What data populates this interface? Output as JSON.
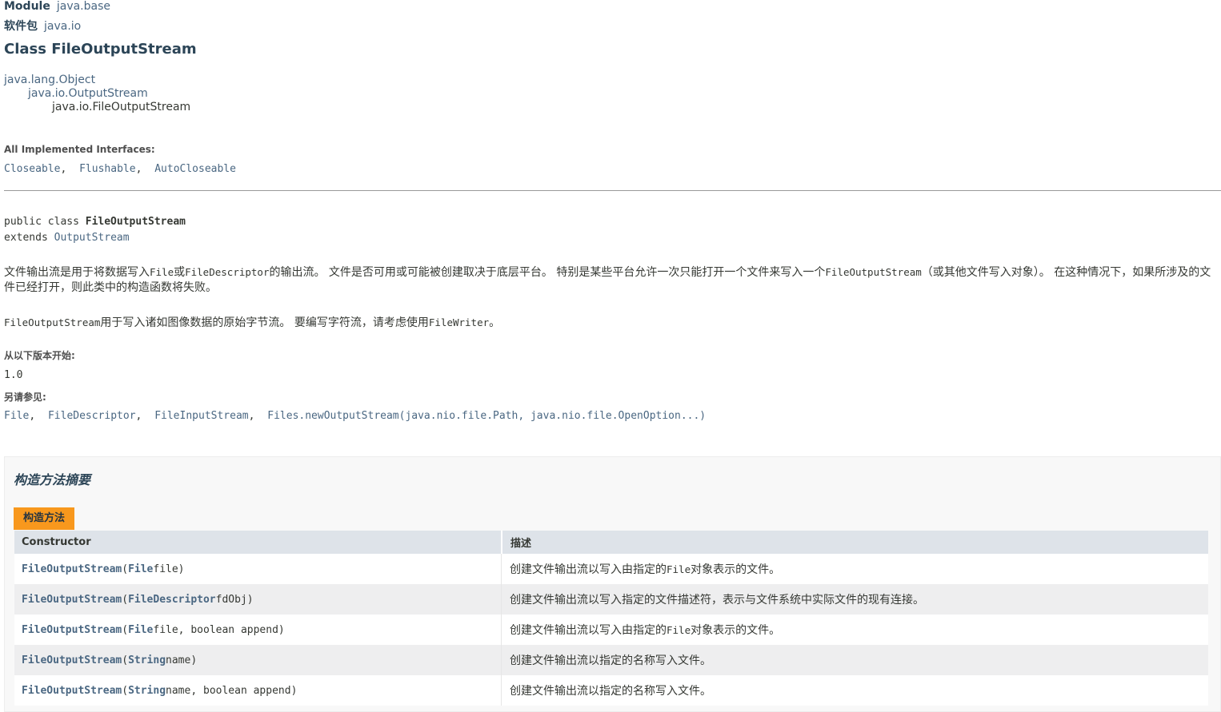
{
  "header": {
    "module_label": "Module",
    "module_value": "java.base",
    "package_label": "软件包",
    "package_value": "java.io",
    "class_title": "Class FileOutputStream"
  },
  "inheritance": [
    "java.lang.Object",
    "java.io.OutputStream",
    "java.io.FileOutputStream"
  ],
  "interfaces": {
    "label": "All Implemented Interfaces:",
    "items": [
      "Closeable",
      "Flushable",
      "AutoCloseable"
    ]
  },
  "signature": {
    "line1_prefix": "public class ",
    "line1_name": "FileOutputStream",
    "line2_prefix": "extends ",
    "line2_link": "OutputStream"
  },
  "description": {
    "p1_a": "文件输出流是用于将数据写入",
    "p1_code1": "File",
    "p1_b": "或",
    "p1_code2": "FileDescriptor",
    "p1_c": "的输出流。 文件是否可用或可能被创建取决于底层平台。 特别是某些平台允许一次只能打开一个文件来写入一个",
    "p1_code3": "FileOutputStream",
    "p1_d": "（或其他文件写入对象）。 在这种情况下，如果所涉及的文件已经打开，则此类中的构造函数将失败。",
    "p2_code1": "FileOutputStream",
    "p2_a": "用于写入诸如图像数据的原始字节流。 要编写字符流，请考虑使用",
    "p2_code2": "FileWriter",
    "p2_b": "。"
  },
  "since": {
    "label": "从以下版本开始:",
    "value": "1.0"
  },
  "see_also": {
    "label": "另请参见:",
    "items": [
      "File",
      "FileDescriptor",
      "FileInputStream",
      "Files.newOutputStream(java.nio.file.Path, java.nio.file.OpenOption...)"
    ]
  },
  "summary": {
    "title": "构造方法摘要",
    "caption": "构造方法",
    "col_constructor": "Constructor",
    "col_desc": "描述",
    "rows": [
      {
        "name": "FileOutputStream",
        "open": "(",
        "type": "File",
        "params": " file)",
        "desc_a": "创建文件输出流以写入由指定的 ",
        "desc_code": "File",
        "desc_b": "对象表示的文件。"
      },
      {
        "name": "FileOutputStream",
        "open": "(",
        "type": "FileDescriptor",
        "params": " fdObj)",
        "desc_a": "创建文件输出流以写入指定的文件描述符，表示与文件系统中实际文件的现有连接。",
        "desc_code": "",
        "desc_b": ""
      },
      {
        "name": "FileOutputStream",
        "open": "(",
        "type": "File",
        "params": " file, boolean append)",
        "desc_a": "创建文件输出流以写入由指定的 ",
        "desc_code": "File",
        "desc_b": "对象表示的文件。"
      },
      {
        "name": "FileOutputStream",
        "open": "(",
        "type": "String",
        "params": " name)",
        "desc_a": "创建文件输出流以指定的名称写入文件。",
        "desc_code": "",
        "desc_b": ""
      },
      {
        "name": "FileOutputStream",
        "open": "(",
        "type": "String",
        "params": " name, boolean append)",
        "desc_a": "创建文件输出流以指定的名称写入文件。",
        "desc_code": "",
        "desc_b": ""
      }
    ]
  },
  "colors": {
    "link": "#4a6782",
    "heading": "#2c4557",
    "caption_bg": "#f8981d",
    "table_head_bg": "#dee3e9",
    "row_alt_bg": "#eeeeef"
  }
}
